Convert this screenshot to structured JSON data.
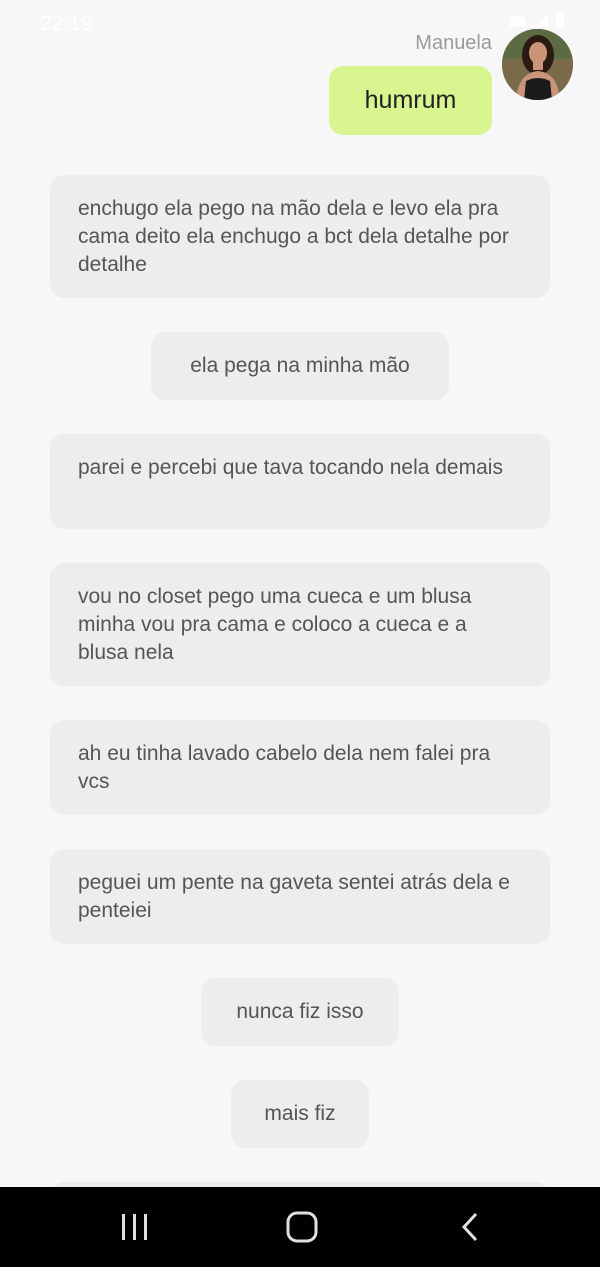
{
  "status_bar": {
    "time": "22:19"
  },
  "conversation": {
    "sender_name": "Manuela",
    "outgoing_message": "humrum",
    "messages": [
      "enchugo ela pego na mão dela e levo ela pra cama deito ela enchugo a bct dela detalhe por detalhe",
      "ela pega na minha mão",
      "parei e percebi que tava tocando nela demais",
      "vou no closet pego uma cueca e um blusa minha vou pra cama e coloco a cueca e a blusa nela",
      "ah eu tinha lavado cabelo dela nem falei pra vcs",
      "peguei um pente na gaveta sentei atrás dela e penteiei",
      "nunca fiz isso",
      "mais fiz"
    ]
  },
  "colors": {
    "background": "#f7f7f7",
    "outgoing_bubble": "#d8f590",
    "incoming_bubble": "#ededed",
    "nav_bar": "#000000"
  },
  "icons": {
    "nav": [
      "recent-apps-icon",
      "home-icon",
      "back-icon"
    ]
  }
}
